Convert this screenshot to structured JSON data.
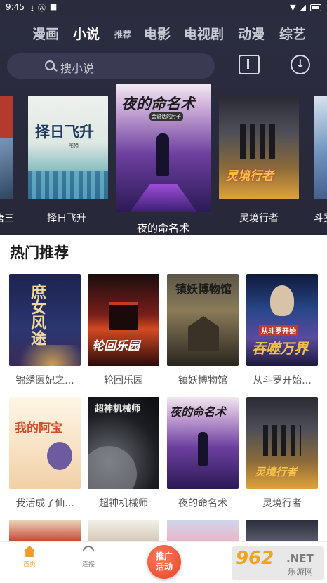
{
  "status_bar": {
    "time": "9:45",
    "icons": [
      "download-icon",
      "a-icon",
      "square-icon"
    ],
    "right_icons": [
      "wifi-icon",
      "signal-icon",
      "battery-icon"
    ]
  },
  "tabs": [
    {
      "label": "漫画"
    },
    {
      "label": "小说",
      "active": true
    },
    {
      "label": "推荐"
    },
    {
      "label": "电影"
    },
    {
      "label": "电视剧"
    },
    {
      "label": "动漫"
    },
    {
      "label": "综艺"
    }
  ],
  "search": {
    "placeholder": "搜小说"
  },
  "carousel": [
    {
      "title": "唐三",
      "cover_text": "",
      "author": ""
    },
    {
      "title": "择日飞升",
      "cover_text": "择日飞升",
      "author": "宅猪"
    },
    {
      "title": "夜的命名术",
      "cover_text": "夜的命名术",
      "author": "会说话的肘子"
    },
    {
      "title": "灵境行者",
      "cover_text": "灵境行者",
      "author": ""
    },
    {
      "title": "斗罗",
      "cover_text": "",
      "author": ""
    }
  ],
  "section": {
    "title": "热门推荐"
  },
  "books": [
    {
      "title": "锦绣医妃之...",
      "cover_text": "庶女风途"
    },
    {
      "title": "轮回乐园",
      "cover_text": "轮回乐园"
    },
    {
      "title": "镇妖博物馆",
      "cover_text": "镇妖博物馆"
    },
    {
      "title": "从斗罗开始...",
      "cover_text": "从斗罗开始"
    },
    {
      "title": "我活成了仙...",
      "cover_text": "我的阿宝"
    },
    {
      "title": "超神机械师",
      "cover_text": "超神机械师"
    },
    {
      "title": "夜的命名术",
      "cover_text": "夜的命名术"
    },
    {
      "title": "灵境行者",
      "cover_text": "灵境行者"
    }
  ],
  "bottom_nav": [
    {
      "label": "首页",
      "icon": "home-icon",
      "active": true
    },
    {
      "label": "连接",
      "icon": "wifi-icon"
    }
  ],
  "promo": {
    "line1": "推广",
    "line2": "活动"
  },
  "watermark": {
    "num": "962",
    "net": ".NET",
    "cn": "乐游网"
  },
  "colors": {
    "header_bg": "#2b2c40",
    "accent": "#f39a2b",
    "promo": "#e7442a"
  }
}
